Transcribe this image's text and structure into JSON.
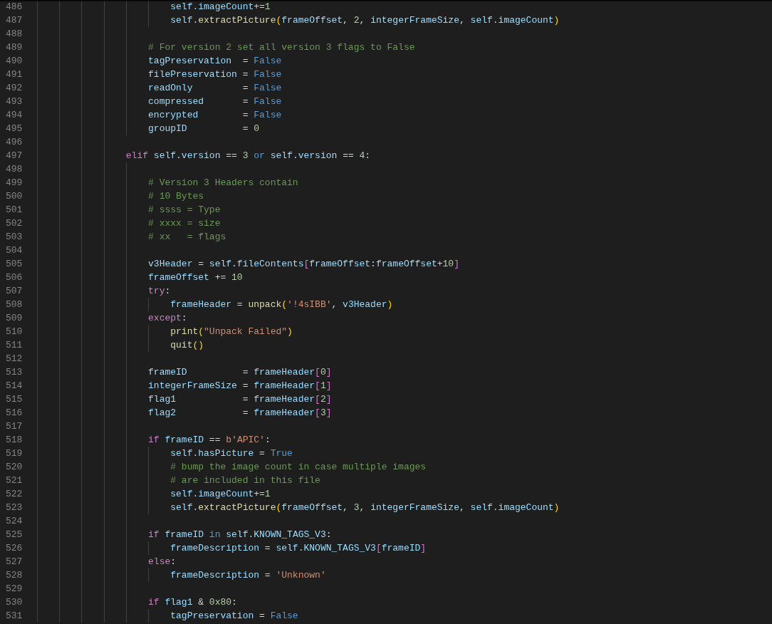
{
  "editor": {
    "lines": [
      {
        "number": "486",
        "tokens": [
          {
            "text": "                        self.imageCount",
            "kind": "v"
          },
          {
            "text": "+=",
            "kind": "p"
          },
          {
            "text": "1",
            "kind": "n"
          }
        ]
      },
      {
        "number": "487",
        "tokens": [
          {
            "text": "                        self.",
            "kind": "v"
          },
          {
            "text": "extractPicture",
            "kind": "f"
          },
          {
            "text": "(",
            "kind": "b1"
          },
          {
            "text": "frameOffset",
            "kind": "v"
          },
          {
            "text": ", ",
            "kind": "p"
          },
          {
            "text": "2",
            "kind": "n"
          },
          {
            "text": ", ",
            "kind": "p"
          },
          {
            "text": "integerFrameSize",
            "kind": "v"
          },
          {
            "text": ", ",
            "kind": "p"
          },
          {
            "text": "self.imageCount",
            "kind": "v"
          },
          {
            "text": ")",
            "kind": "b1"
          }
        ]
      },
      {
        "number": "488"
      },
      {
        "number": "489",
        "tokens": [
          {
            "text": "                    # For version 2 set all version 3 flags to False",
            "kind": "m"
          }
        ]
      },
      {
        "number": "490",
        "tokens": [
          {
            "text": "                    tagPreservation",
            "kind": "v"
          },
          {
            "text": "  = ",
            "kind": "p"
          },
          {
            "text": "False",
            "kind": "c"
          }
        ]
      },
      {
        "number": "491",
        "tokens": [
          {
            "text": "                    filePreservation",
            "kind": "v"
          },
          {
            "text": " = ",
            "kind": "p"
          },
          {
            "text": "False",
            "kind": "c"
          }
        ]
      },
      {
        "number": "492",
        "tokens": [
          {
            "text": "                    readOnly",
            "kind": "v"
          },
          {
            "text": "         = ",
            "kind": "p"
          },
          {
            "text": "False",
            "kind": "c"
          }
        ]
      },
      {
        "number": "493",
        "tokens": [
          {
            "text": "                    compressed",
            "kind": "v"
          },
          {
            "text": "       = ",
            "kind": "p"
          },
          {
            "text": "False",
            "kind": "c"
          }
        ]
      },
      {
        "number": "494",
        "tokens": [
          {
            "text": "                    encrypted",
            "kind": "v"
          },
          {
            "text": "        = ",
            "kind": "p"
          },
          {
            "text": "False",
            "kind": "c"
          }
        ]
      },
      {
        "number": "495",
        "tokens": [
          {
            "text": "                    groupID",
            "kind": "v"
          },
          {
            "text": "          = ",
            "kind": "p"
          },
          {
            "text": "0",
            "kind": "n"
          }
        ]
      },
      {
        "number": "496"
      },
      {
        "number": "497",
        "tokens": [
          {
            "text": "                elif",
            "kind": "k"
          },
          {
            "text": " self.version",
            "kind": "v"
          },
          {
            "text": " == ",
            "kind": "p"
          },
          {
            "text": "3",
            "kind": "n"
          },
          {
            "text": " or ",
            "kind": "c"
          },
          {
            "text": "self.version",
            "kind": "v"
          },
          {
            "text": " == ",
            "kind": "p"
          },
          {
            "text": "4",
            "kind": "n"
          },
          {
            "text": ":",
            "kind": "p"
          }
        ]
      },
      {
        "number": "498"
      },
      {
        "number": "499",
        "tokens": [
          {
            "text": "                    # Version 3 Headers contain",
            "kind": "m"
          }
        ]
      },
      {
        "number": "500",
        "tokens": [
          {
            "text": "                    # 10 Bytes",
            "kind": "m"
          }
        ]
      },
      {
        "number": "501",
        "tokens": [
          {
            "text": "                    # ssss = Type",
            "kind": "m"
          }
        ]
      },
      {
        "number": "502",
        "tokens": [
          {
            "text": "                    # xxxx = size",
            "kind": "m"
          }
        ]
      },
      {
        "number": "503",
        "tokens": [
          {
            "text": "                    # xx   = flags",
            "kind": "m"
          }
        ]
      },
      {
        "number": "504"
      },
      {
        "number": "505",
        "tokens": [
          {
            "text": "                    v3Header",
            "kind": "v"
          },
          {
            "text": " = ",
            "kind": "p"
          },
          {
            "text": "self.fileContents",
            "kind": "v"
          },
          {
            "text": "[",
            "kind": "b2"
          },
          {
            "text": "frameOffset",
            "kind": "v"
          },
          {
            "text": ":",
            "kind": "p"
          },
          {
            "text": "frameOffset",
            "kind": "v"
          },
          {
            "text": "+",
            "kind": "p"
          },
          {
            "text": "10",
            "kind": "n"
          },
          {
            "text": "]",
            "kind": "b2"
          }
        ]
      },
      {
        "number": "506",
        "tokens": [
          {
            "text": "                    frameOffset",
            "kind": "v"
          },
          {
            "text": " += ",
            "kind": "p"
          },
          {
            "text": "10",
            "kind": "n"
          }
        ]
      },
      {
        "number": "507",
        "tokens": [
          {
            "text": "                    try",
            "kind": "k"
          },
          {
            "text": ":",
            "kind": "p"
          }
        ]
      },
      {
        "number": "508",
        "tokens": [
          {
            "text": "                        frameHeader",
            "kind": "v"
          },
          {
            "text": " = ",
            "kind": "p"
          },
          {
            "text": "unpack",
            "kind": "f"
          },
          {
            "text": "(",
            "kind": "b1"
          },
          {
            "text": "'!4sIBB'",
            "kind": "s"
          },
          {
            "text": ", ",
            "kind": "p"
          },
          {
            "text": "v3Header",
            "kind": "v"
          },
          {
            "text": ")",
            "kind": "b1"
          }
        ]
      },
      {
        "number": "509",
        "tokens": [
          {
            "text": "                    except",
            "kind": "k"
          },
          {
            "text": ":",
            "kind": "p"
          }
        ]
      },
      {
        "number": "510",
        "tokens": [
          {
            "text": "                        print",
            "kind": "f"
          },
          {
            "text": "(",
            "kind": "b1"
          },
          {
            "text": "\"Unpack Failed\"",
            "kind": "s"
          },
          {
            "text": ")",
            "kind": "b1"
          }
        ]
      },
      {
        "number": "511",
        "tokens": [
          {
            "text": "                        quit",
            "kind": "f"
          },
          {
            "text": "()",
            "kind": "b1"
          }
        ]
      },
      {
        "number": "512"
      },
      {
        "number": "513",
        "tokens": [
          {
            "text": "                    frameID",
            "kind": "v"
          },
          {
            "text": "          = ",
            "kind": "p"
          },
          {
            "text": "frameHeader",
            "kind": "v"
          },
          {
            "text": "[",
            "kind": "b2"
          },
          {
            "text": "0",
            "kind": "n"
          },
          {
            "text": "]",
            "kind": "b2"
          }
        ]
      },
      {
        "number": "514",
        "tokens": [
          {
            "text": "                    integerFrameSize",
            "kind": "v"
          },
          {
            "text": " = ",
            "kind": "p"
          },
          {
            "text": "frameHeader",
            "kind": "v"
          },
          {
            "text": "[",
            "kind": "b2"
          },
          {
            "text": "1",
            "kind": "n"
          },
          {
            "text": "]",
            "kind": "b2"
          }
        ]
      },
      {
        "number": "515",
        "tokens": [
          {
            "text": "                    flag1",
            "kind": "v"
          },
          {
            "text": "            = ",
            "kind": "p"
          },
          {
            "text": "frameHeader",
            "kind": "v"
          },
          {
            "text": "[",
            "kind": "b2"
          },
          {
            "text": "2",
            "kind": "n"
          },
          {
            "text": "]",
            "kind": "b2"
          }
        ]
      },
      {
        "number": "516",
        "tokens": [
          {
            "text": "                    flag2",
            "kind": "v"
          },
          {
            "text": "            = ",
            "kind": "p"
          },
          {
            "text": "frameHeader",
            "kind": "v"
          },
          {
            "text": "[",
            "kind": "b2"
          },
          {
            "text": "3",
            "kind": "n"
          },
          {
            "text": "]",
            "kind": "b2"
          }
        ]
      },
      {
        "number": "517"
      },
      {
        "number": "518",
        "tokens": [
          {
            "text": "                    if",
            "kind": "k"
          },
          {
            "text": " frameID",
            "kind": "v"
          },
          {
            "text": " == ",
            "kind": "p"
          },
          {
            "text": "b'APIC'",
            "kind": "s"
          },
          {
            "text": ":",
            "kind": "p"
          }
        ]
      },
      {
        "number": "519",
        "tokens": [
          {
            "text": "                        self.hasPicture",
            "kind": "v"
          },
          {
            "text": " = ",
            "kind": "p"
          },
          {
            "text": "True",
            "kind": "c"
          }
        ]
      },
      {
        "number": "520",
        "tokens": [
          {
            "text": "                        # bump the image count in case multiple images",
            "kind": "m"
          }
        ]
      },
      {
        "number": "521",
        "tokens": [
          {
            "text": "                        # are included in this file",
            "kind": "m"
          }
        ]
      },
      {
        "number": "522",
        "tokens": [
          {
            "text": "                        self.imageCount",
            "kind": "v"
          },
          {
            "text": "+=",
            "kind": "p"
          },
          {
            "text": "1",
            "kind": "n"
          }
        ]
      },
      {
        "number": "523",
        "tokens": [
          {
            "text": "                        self.",
            "kind": "v"
          },
          {
            "text": "extractPicture",
            "kind": "f"
          },
          {
            "text": "(",
            "kind": "b1"
          },
          {
            "text": "frameOffset",
            "kind": "v"
          },
          {
            "text": ", ",
            "kind": "p"
          },
          {
            "text": "3",
            "kind": "n"
          },
          {
            "text": ", ",
            "kind": "p"
          },
          {
            "text": "integerFrameSize",
            "kind": "v"
          },
          {
            "text": ", ",
            "kind": "p"
          },
          {
            "text": "self.imageCount",
            "kind": "v"
          },
          {
            "text": ")",
            "kind": "b1"
          }
        ]
      },
      {
        "number": "524"
      },
      {
        "number": "525",
        "tokens": [
          {
            "text": "                    if",
            "kind": "k"
          },
          {
            "text": " frameID ",
            "kind": "v"
          },
          {
            "text": "in",
            "kind": "c"
          },
          {
            "text": " self.KNOWN_TAGS_V3",
            "kind": "v"
          },
          {
            "text": ":",
            "kind": "p"
          }
        ]
      },
      {
        "number": "526",
        "tokens": [
          {
            "text": "                        frameDescription",
            "kind": "v"
          },
          {
            "text": " = ",
            "kind": "p"
          },
          {
            "text": "self.KNOWN_TAGS_V3",
            "kind": "v"
          },
          {
            "text": "[",
            "kind": "b2"
          },
          {
            "text": "frameID",
            "kind": "v"
          },
          {
            "text": "]",
            "kind": "b2"
          }
        ]
      },
      {
        "number": "527",
        "tokens": [
          {
            "text": "                    else",
            "kind": "k"
          },
          {
            "text": ":",
            "kind": "p"
          }
        ]
      },
      {
        "number": "528",
        "tokens": [
          {
            "text": "                        frameDescription",
            "kind": "v"
          },
          {
            "text": " = ",
            "kind": "p"
          },
          {
            "text": "'Unknown'",
            "kind": "s"
          }
        ]
      },
      {
        "number": "529"
      },
      {
        "number": "530",
        "tokens": [
          {
            "text": "                    if",
            "kind": "k"
          },
          {
            "text": " flag1",
            "kind": "v"
          },
          {
            "text": " & ",
            "kind": "p"
          },
          {
            "text": "0x80",
            "kind": "n"
          },
          {
            "text": ":",
            "kind": "p"
          }
        ]
      },
      {
        "number": "531",
        "tokens": [
          {
            "text": "                        tagPreservation",
            "kind": "v"
          },
          {
            "text": " = ",
            "kind": "p"
          },
          {
            "text": "False",
            "kind": "c"
          }
        ]
      }
    ]
  }
}
